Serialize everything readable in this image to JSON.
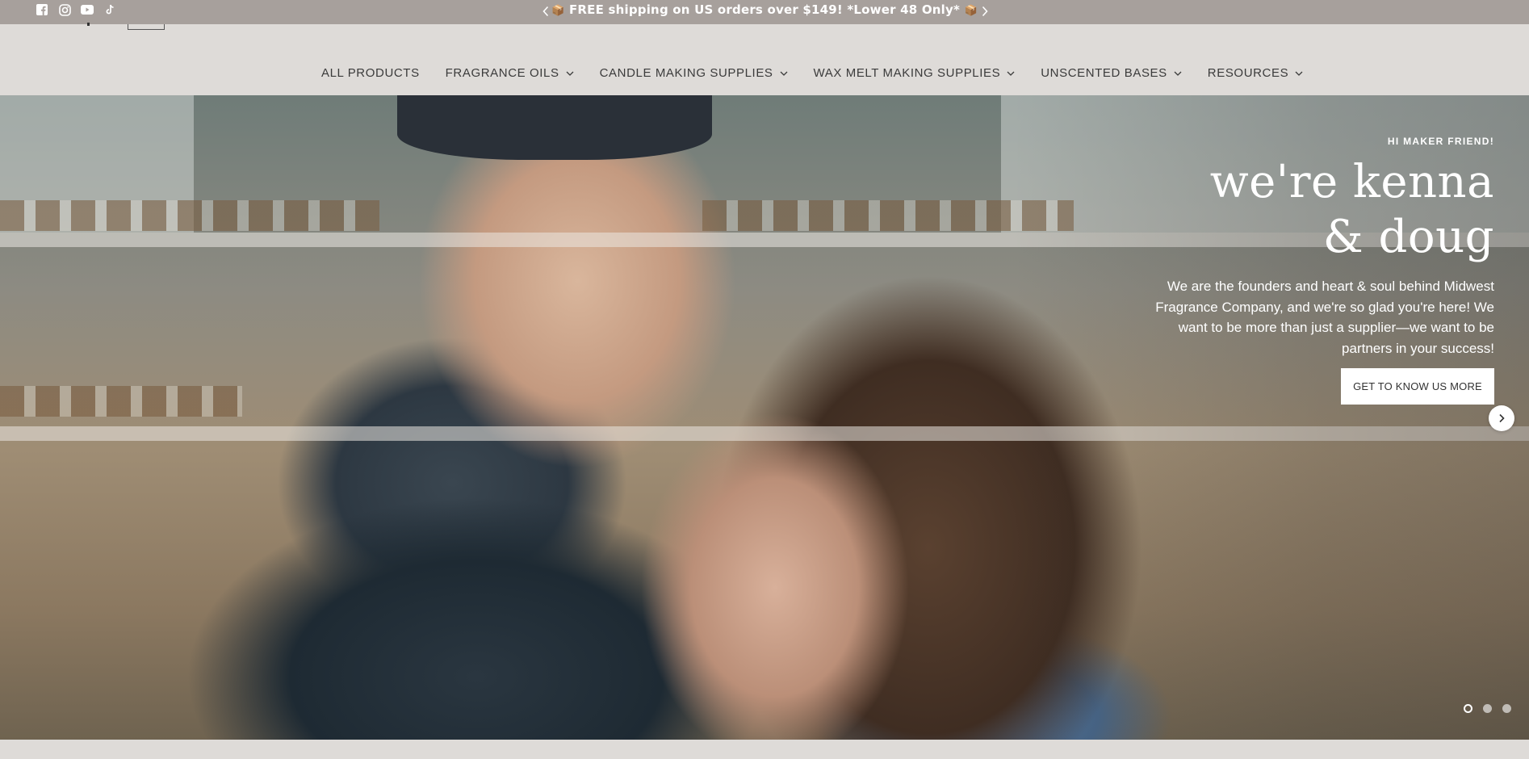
{
  "announcement": {
    "text": "FREE shipping on US orders over $149! *Lower 48 Only*",
    "prefix_emoji": "📦",
    "suffix_emoji": "📦"
  },
  "social": [
    "facebook-icon",
    "instagram-icon",
    "youtube-icon",
    "tiktok-icon"
  ],
  "nav": {
    "items": [
      {
        "label": "ALL PRODUCTS",
        "dropdown": false
      },
      {
        "label": "FRAGRANCE OILS",
        "dropdown": true
      },
      {
        "label": "CANDLE MAKING SUPPLIES",
        "dropdown": true
      },
      {
        "label": "WAX MELT MAKING SUPPLIES",
        "dropdown": true
      },
      {
        "label": "UNSCENTED BASES",
        "dropdown": true
      },
      {
        "label": "RESOURCES",
        "dropdown": true
      }
    ]
  },
  "hero": {
    "eyebrow": "HI MAKER FRIEND!",
    "headline_line1": "we're kenna",
    "headline_line2": "& doug",
    "body": "We are the founders and heart & soul behind Midwest Fragrance Company, and we're so glad you're here! We want to be more than just a supplier—we want to be partners in your success!",
    "cta_label": "GET TO KNOW US MORE",
    "slides_total": 3,
    "active_slide": 1
  },
  "colors": {
    "announcement_bg": "#a7a09c",
    "nav_bg": "#dedbd8",
    "nav_text": "#3b3b3b",
    "button_bg": "#ffffff"
  }
}
